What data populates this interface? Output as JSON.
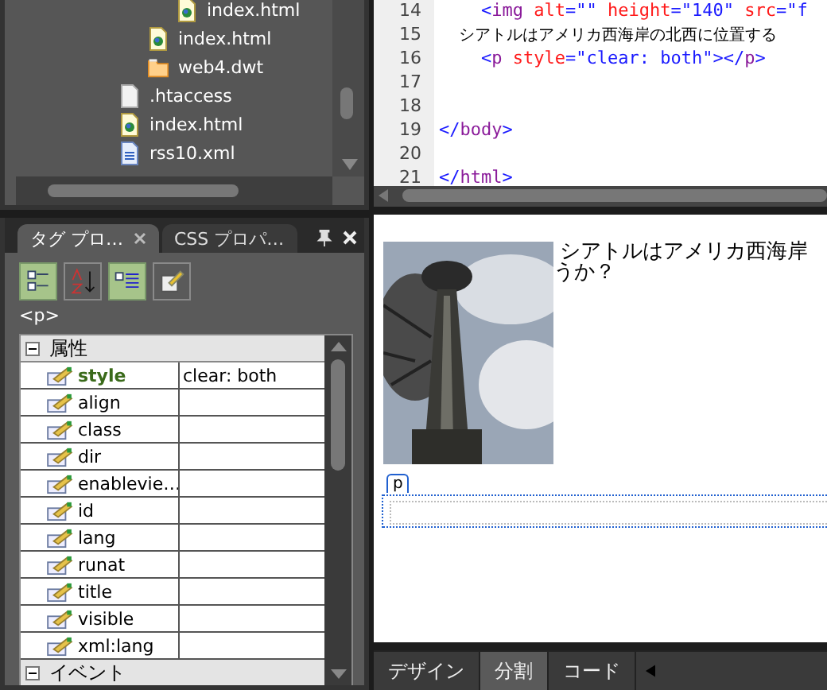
{
  "file_tree": {
    "items": [
      {
        "children": [
          {
            "children": [
              {
                "label": "index.html",
                "kind": "page"
              }
            ]
          },
          {
            "label": "index.html",
            "kind": "page"
          },
          {
            "label": "web4.dwt",
            "kind": "folder"
          }
        ]
      },
      {
        "label": ".htaccess",
        "kind": "blank"
      },
      {
        "label": "index.html",
        "kind": "page"
      },
      {
        "label": "rss10.xml",
        "kind": "xml"
      }
    ]
  },
  "code_editor": {
    "lines": [
      {
        "number": "14",
        "tokens": [
          {
            "kind": "punct",
            "text": "    <"
          },
          {
            "kind": "tag",
            "text": "img"
          },
          {
            "kind": "attr",
            "text": " alt"
          },
          {
            "kind": "punct",
            "text": "="
          },
          {
            "kind": "value",
            "text": "\"\""
          },
          {
            "kind": "attr",
            "text": " height"
          },
          {
            "kind": "punct",
            "text": "="
          },
          {
            "kind": "value",
            "text": "\"140\""
          },
          {
            "kind": "attr",
            "text": " src"
          },
          {
            "kind": "punct",
            "text": "="
          },
          {
            "kind": "value",
            "text": "\"f"
          }
        ]
      },
      {
        "number": "15",
        "tokens": [
          {
            "kind": "text",
            "text": "    シアトルはアメリカ西海岸の北西に位置する"
          }
        ]
      },
      {
        "number": "16",
        "tokens": [
          {
            "kind": "punct",
            "text": "    <"
          },
          {
            "kind": "tag",
            "text": "p"
          },
          {
            "kind": "attr",
            "text": " style"
          },
          {
            "kind": "punct",
            "text": "="
          },
          {
            "kind": "value",
            "text": "\"clear: both\""
          },
          {
            "kind": "punct",
            "text": ">"
          },
          {
            "kind": "punct",
            "text": "</"
          },
          {
            "kind": "tag",
            "text": "p"
          },
          {
            "kind": "punct",
            "text": ">"
          }
        ]
      },
      {
        "number": "17"
      },
      {
        "number": "18"
      },
      {
        "number": "19",
        "tokens": [
          {
            "kind": "punct",
            "text": "</"
          },
          {
            "kind": "tag",
            "text": "body"
          },
          {
            "kind": "punct",
            "text": ">"
          }
        ]
      },
      {
        "number": "20"
      },
      {
        "number": "21",
        "tokens": [
          {
            "kind": "punct",
            "text": "</"
          },
          {
            "kind": "tag",
            "text": "html"
          },
          {
            "kind": "punct",
            "text": ">"
          }
        ]
      }
    ]
  },
  "panel_tabs": [
    {
      "label": "タグ プロ…",
      "selected": true
    },
    {
      "label": "CSS プロパ…",
      "selected": false
    }
  ],
  "toolbar": [
    {
      "kind": "category",
      "selected": true
    },
    {
      "kind": "sort",
      "selected": false
    },
    {
      "kind": "list",
      "selected": true
    },
    {
      "kind": "edit",
      "selected": false
    }
  ],
  "selected_tag": "<p>",
  "properties": [
    {
      "group": "属性",
      "expanded": true,
      "rows": [
        {
          "name": "style",
          "value": "clear: both",
          "modified": true
        },
        {
          "name": "align",
          "modified": false
        },
        {
          "name": "class",
          "modified": false
        },
        {
          "name": "dir",
          "modified": false
        },
        {
          "name": "enablevie…",
          "modified": false
        },
        {
          "name": "id",
          "modified": false
        },
        {
          "name": "lang",
          "modified": false
        },
        {
          "name": "runat",
          "modified": false
        },
        {
          "name": "title",
          "modified": false
        },
        {
          "name": "visible",
          "modified": false
        },
        {
          "name": "xml:lang",
          "modified": false
        }
      ]
    },
    {
      "group": "イベント",
      "expanded": true
    }
  ],
  "design_view": {
    "text_lines": [
      "シアトルはアメリカ西海岸",
      "うか？"
    ],
    "tag_label": "p"
  },
  "view_tabs": [
    {
      "label": "デザイン",
      "selected": false
    },
    {
      "label": "分割",
      "selected": true
    },
    {
      "label": "コード",
      "selected": false
    }
  ]
}
